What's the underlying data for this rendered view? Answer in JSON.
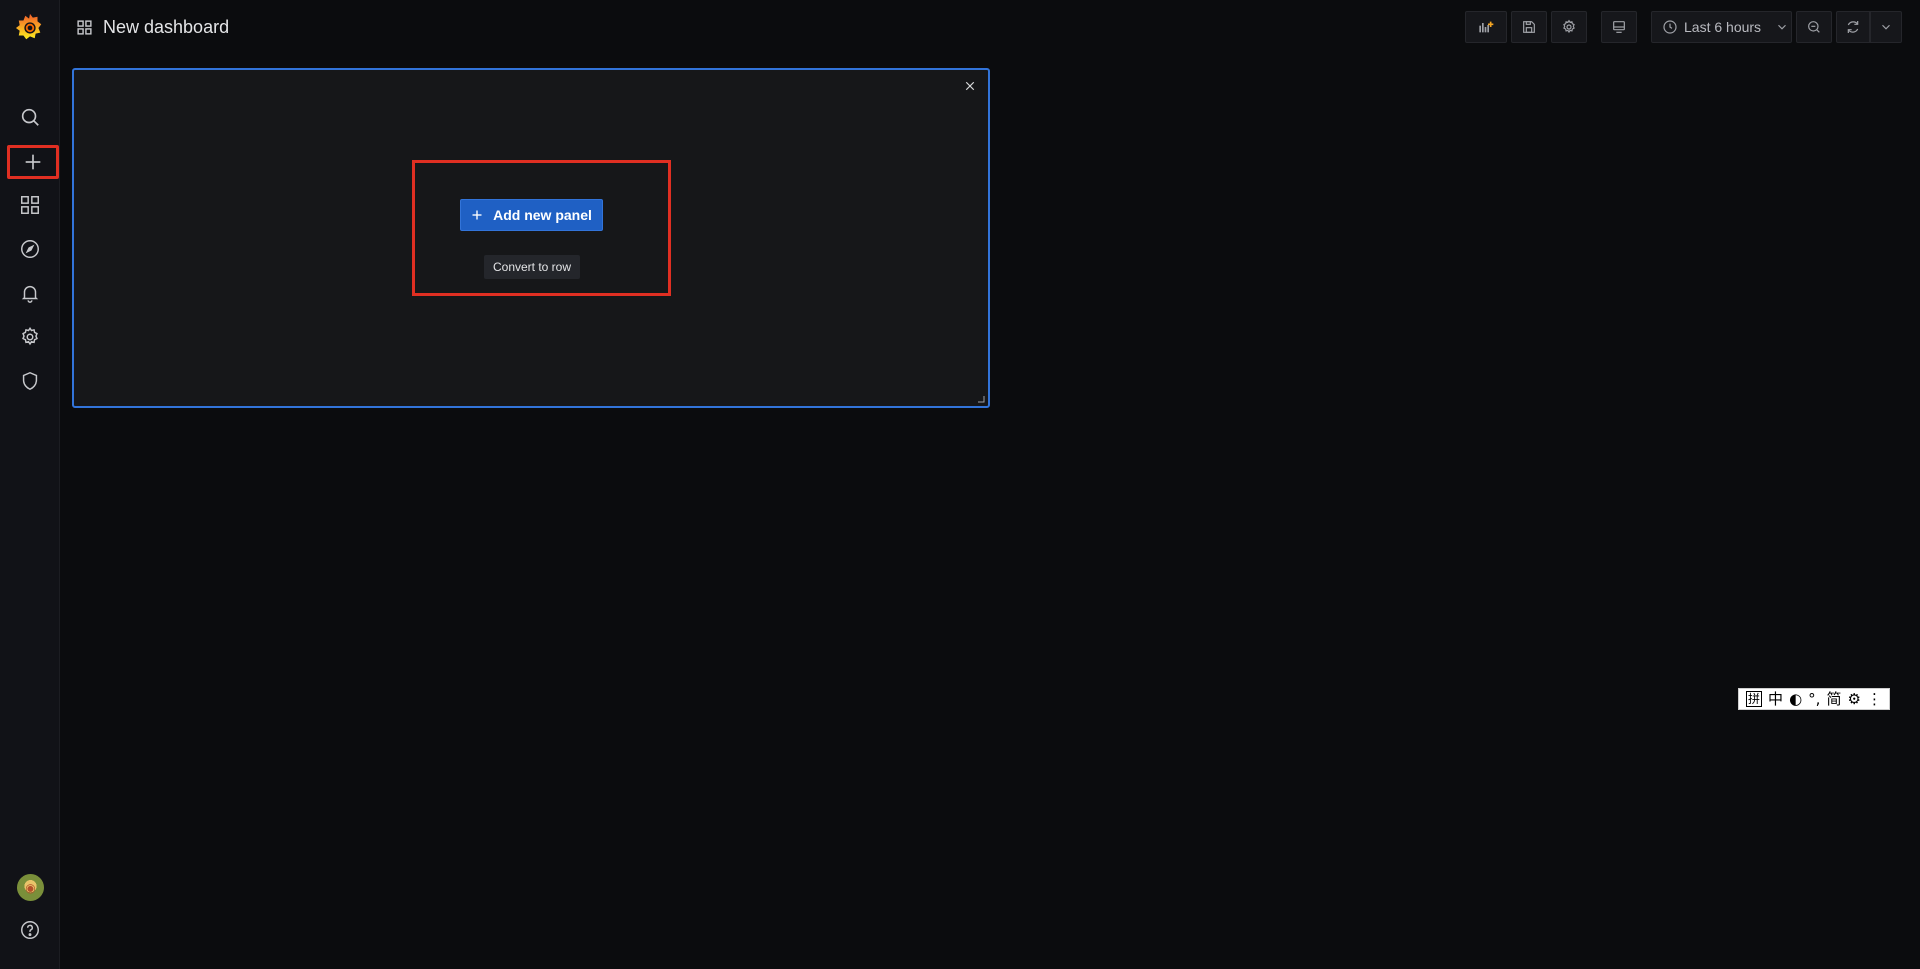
{
  "app": {
    "dashboard_title": "New dashboard"
  },
  "sidebar": {
    "items": [
      {
        "name": "search",
        "icon": "search-icon"
      },
      {
        "name": "create",
        "icon": "plus-icon",
        "highlighted": true
      },
      {
        "name": "dashboards",
        "icon": "apps-icon"
      },
      {
        "name": "explore",
        "icon": "compass-icon"
      },
      {
        "name": "alerting",
        "icon": "bell-icon"
      },
      {
        "name": "configuration",
        "icon": "gear-icon"
      },
      {
        "name": "server-admin",
        "icon": "shield-icon"
      }
    ],
    "bottom": [
      {
        "name": "profile",
        "icon": "avatar"
      },
      {
        "name": "help",
        "icon": "question-icon"
      }
    ]
  },
  "toolbar": {
    "time_range_label": "Last 6 hours",
    "buttons": [
      "add-panel-icon",
      "save-icon",
      "gear-icon",
      "tv-icon",
      "clock-icon",
      "zoom-out-icon",
      "refresh-icon",
      "chevron-down-icon"
    ]
  },
  "panel": {
    "add_new_panel_label": "Add new panel",
    "convert_to_row_label": "Convert to row"
  },
  "ime_bar": {
    "items": [
      "拼",
      "中",
      "◐",
      "°,",
      "简",
      "⚙",
      "⋮"
    ]
  },
  "colors": {
    "background": "#0b0c0e",
    "sidebar": "#111217",
    "panel_border": "#3274d9",
    "primary_button": "#1f60c4",
    "highlight": "#e02f22",
    "logo_orange": "#f46800"
  }
}
